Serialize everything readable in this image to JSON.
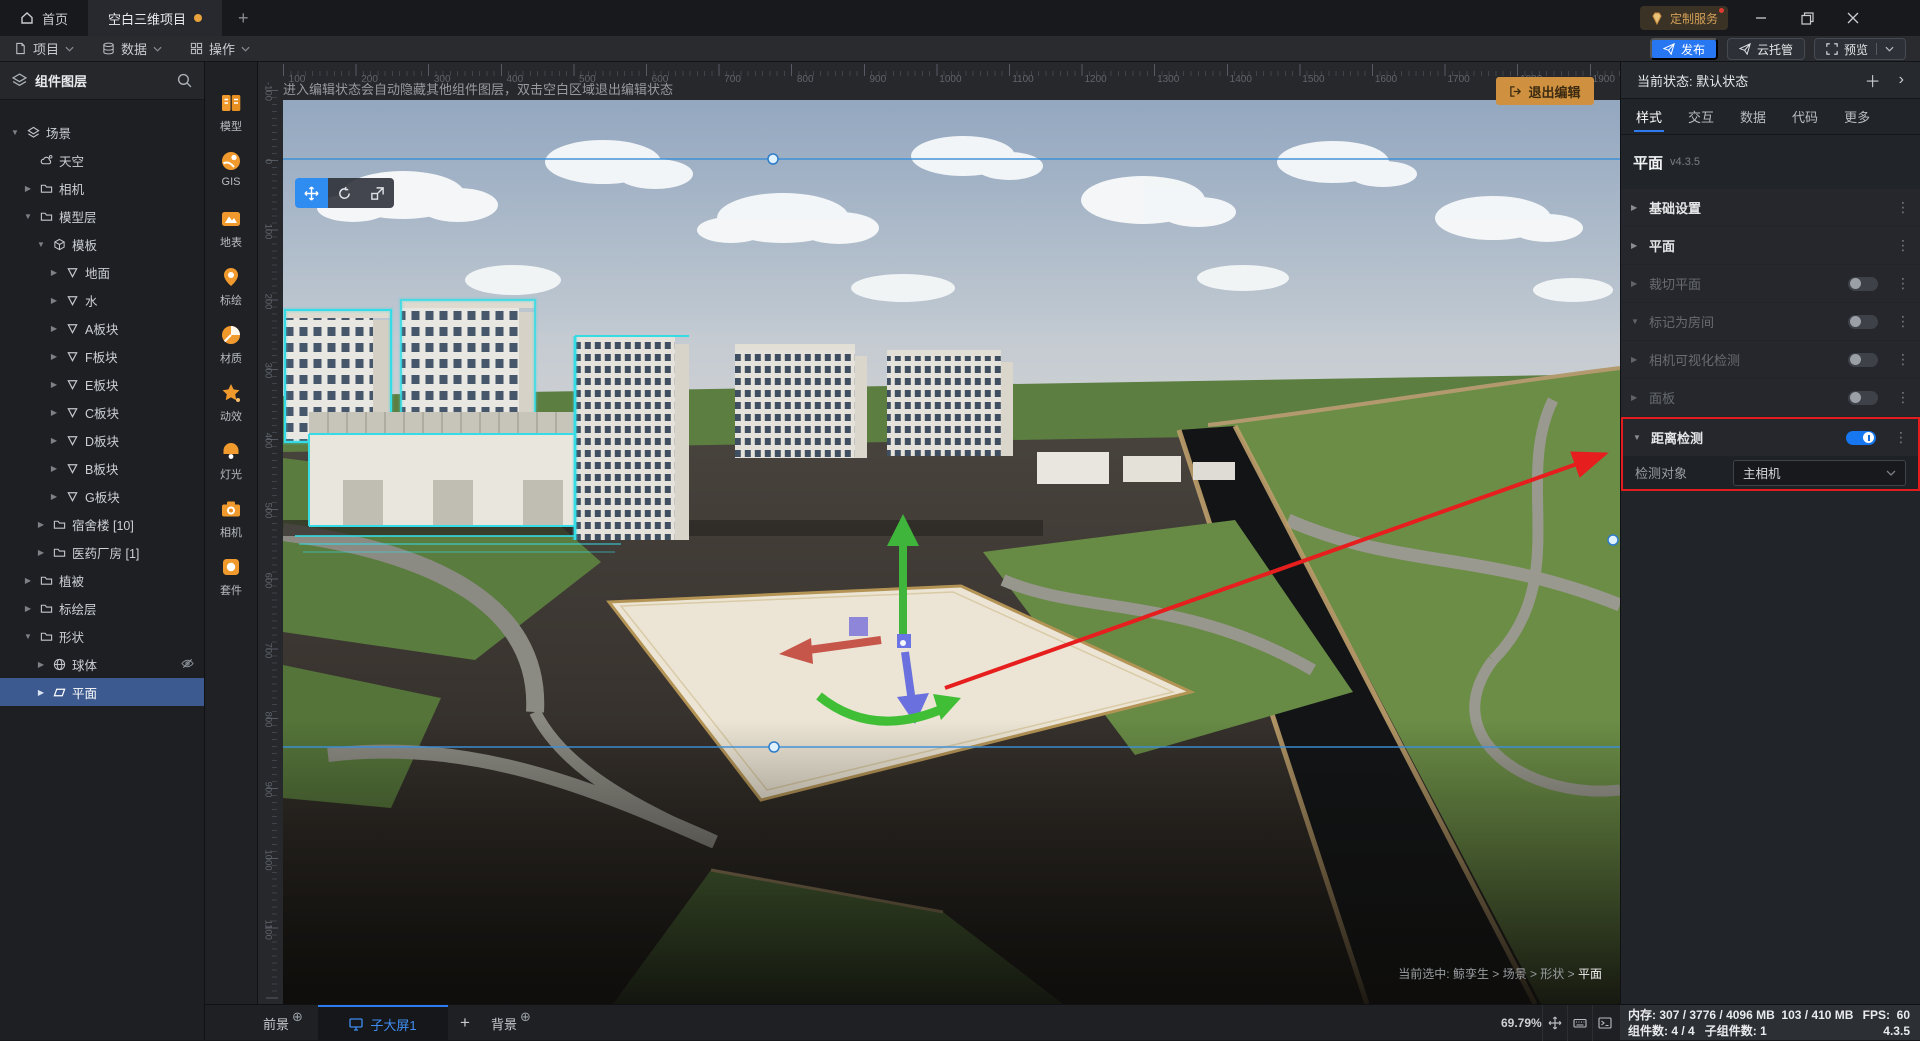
{
  "colors": {
    "accent": "#2E7BF0",
    "orange": "#F09A2E",
    "toggle_on": "#1677F0",
    "annotation_red": "#E31D1D",
    "selected_row": "#3C5A8F",
    "exit_button": "#CF9140",
    "neon_cyan": "#35DCE6"
  },
  "titlebar": {
    "home_tab": "首页",
    "project_tab": "空白三维项目",
    "new_tab": "+",
    "custom_service": "定制服务"
  },
  "menubar": {
    "items": [
      "项目",
      "数据",
      "操作"
    ],
    "publish": "发布",
    "cloud_host": "云托管",
    "preview": "预览"
  },
  "sidebar": {
    "title": "组件图层",
    "tree": [
      {
        "label": "场景",
        "level": 0,
        "caret": "down",
        "icon": "scene"
      },
      {
        "label": "天空",
        "level": 1,
        "caret": "none",
        "icon": "sky"
      },
      {
        "label": "相机",
        "level": 1,
        "caret": "right",
        "icon": "folder"
      },
      {
        "label": "模型层",
        "level": 1,
        "caret": "down",
        "icon": "folder"
      },
      {
        "label": "模板",
        "level": 2,
        "caret": "down",
        "icon": "cube"
      },
      {
        "label": "地面",
        "level": 3,
        "caret": "right",
        "icon": "nabla"
      },
      {
        "label": "水",
        "level": 3,
        "caret": "right",
        "icon": "nabla"
      },
      {
        "label": "A板块",
        "level": 3,
        "caret": "right",
        "icon": "nabla"
      },
      {
        "label": "F板块",
        "level": 3,
        "caret": "right",
        "icon": "nabla"
      },
      {
        "label": "E板块",
        "level": 3,
        "caret": "right",
        "icon": "nabla"
      },
      {
        "label": "C板块",
        "level": 3,
        "caret": "right",
        "icon": "nabla"
      },
      {
        "label": "D板块",
        "level": 3,
        "caret": "right",
        "icon": "nabla"
      },
      {
        "label": "B板块",
        "level": 3,
        "caret": "right",
        "icon": "nabla"
      },
      {
        "label": "G板块",
        "level": 3,
        "caret": "right",
        "icon": "nabla"
      },
      {
        "label": "宿舍楼 [10]",
        "level": 2,
        "caret": "right",
        "icon": "folder"
      },
      {
        "label": "医药厂房 [1]",
        "level": 2,
        "caret": "right",
        "icon": "folder"
      },
      {
        "label": "植被",
        "level": 1,
        "caret": "right",
        "icon": "folder"
      },
      {
        "label": "标绘层",
        "level": 1,
        "caret": "right",
        "icon": "folder"
      },
      {
        "label": "形状",
        "level": 1,
        "caret": "down",
        "icon": "folder"
      },
      {
        "label": "球体",
        "level": 2,
        "caret": "right",
        "icon": "globe",
        "hidden": true
      },
      {
        "label": "平面",
        "level": 2,
        "caret": "right",
        "icon": "plane",
        "selected": true
      }
    ]
  },
  "toolrail": {
    "items": [
      {
        "label": "模型",
        "icon": "model"
      },
      {
        "label": "GIS",
        "icon": "gis"
      },
      {
        "label": "地表",
        "icon": "terrain"
      },
      {
        "label": "标绘",
        "icon": "plot"
      },
      {
        "label": "材质",
        "icon": "material"
      },
      {
        "label": "动效",
        "icon": "effect"
      },
      {
        "label": "灯光",
        "icon": "light"
      },
      {
        "label": "相机",
        "icon": "camera"
      },
      {
        "label": "套件",
        "icon": "kit"
      }
    ]
  },
  "canvas": {
    "tip": "进入编辑状态会自动隐藏其他组件图层，双击空白区域退出编辑状态",
    "exit_edit": "退出编辑",
    "gizmo_tools": [
      "move",
      "rotate",
      "scale"
    ],
    "h_ruler": [
      100,
      200,
      300,
      400,
      500,
      600,
      700,
      800,
      900,
      1000,
      1100,
      1200,
      1300,
      1400,
      1500,
      1600,
      1700,
      1800,
      1900
    ],
    "v_ruler": [
      -100,
      0,
      100,
      200,
      300,
      400,
      500,
      600,
      700,
      800,
      900,
      1000,
      1100
    ],
    "selected_info": {
      "prefix_text": "当前选中: 鲸孪生 > 场景 > 形状 > ",
      "current": "平面"
    }
  },
  "inspector": {
    "state_label": "当前状态: 默认状态",
    "tabs": [
      "样式",
      "交互",
      "数据",
      "代码",
      "更多"
    ],
    "active_tab": "样式",
    "component_name": "平面",
    "component_version": "v4.3.5",
    "sections": [
      {
        "label": "基础设置",
        "caret": "right",
        "state": "normal"
      },
      {
        "label": "平面",
        "caret": "right",
        "state": "normal"
      },
      {
        "label": "裁切平面",
        "caret": "right",
        "state": "disabled",
        "toggle": "off"
      },
      {
        "label": "标记为房间",
        "caret": "down",
        "state": "disabled",
        "toggle": "off"
      },
      {
        "label": "相机可视化检测",
        "caret": "right",
        "state": "disabled",
        "toggle": "off"
      },
      {
        "label": "面板",
        "caret": "right",
        "state": "disabled",
        "toggle": "off"
      },
      {
        "label": "距离检测",
        "caret": "down",
        "state": "normal",
        "toggle": "on",
        "highlighted": true
      }
    ],
    "detection_field": {
      "label": "检测对象",
      "value": "主相机"
    }
  },
  "bottombar": {
    "foreground": "前景",
    "screens": [
      {
        "label": "子大屏1",
        "active": true
      }
    ],
    "add": "+",
    "background": "背景",
    "zoom": "69.79%"
  },
  "statusbar": {
    "memory_label": "内存:",
    "memory_value": "307 / 3776 / 4096 MB  103 / 410 MB",
    "fps_label": "FPS:",
    "fps_value": "60",
    "components_label": "组件数:",
    "components_value": "4 / 4",
    "children_label": "子组件数:",
    "children_value": "1",
    "version": "4.3.5"
  }
}
